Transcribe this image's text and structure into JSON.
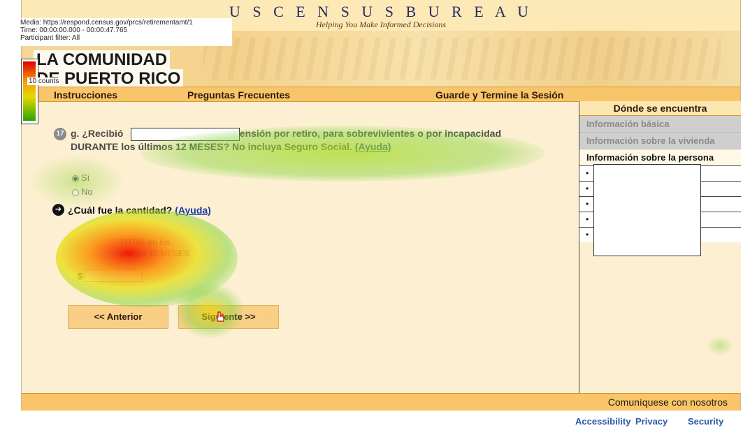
{
  "overlay": {
    "media": "Media: https://respond.census.gov/prcs/retirementamt/1",
    "time": "Time: 00:00:00.000 - 00:00:47.765",
    "participant_filter": "Participant filter: All",
    "legend_label": "10 counts"
  },
  "header": {
    "brand": "U S C E N S U S B U R E A U",
    "tagline": "Helping You Make Informed Decisions",
    "banner_line1": "LA COMUNIDAD",
    "banner_line2": "DE PUERTO RICO"
  },
  "nav": {
    "instrucciones": "Instrucciones",
    "preguntas": "Preguntas Frecuentes",
    "guarde": "Guarde y Termine la Sesión"
  },
  "question": {
    "number": "17",
    "text_start": "g. ¿Recibió",
    "text_rest": "pensión por retiro, para sobrevivientes o por incapacidad DURANTE los últimos 12 MESES? No incluya Seguro Social.",
    "help": "(Ayuda)",
    "option_yes": "Sí",
    "option_no": "No",
    "option_yes_selected": true
  },
  "followup": {
    "label": "¿Cuál fue la cantidad?",
    "help": "(Ayuda)",
    "period_line1": "TOTAL en los",
    "period_line2": "últimos 12 MESES",
    "dollar_sign": "$",
    "amount_value": ""
  },
  "buttons": {
    "previous": "<<  Anterior",
    "next": "Siguiente  >>"
  },
  "sidebar": {
    "title": "Dónde se encuentra",
    "items": [
      {
        "label": "Información básica",
        "state": "done"
      },
      {
        "label": "Información sobre la vivienda",
        "state": "done"
      },
      {
        "label": "Información sobre la persona",
        "state": "current"
      }
    ],
    "bullet": "•"
  },
  "footer": {
    "contact": "Comuníquese con nosotros",
    "accessibility": "Accessibility",
    "privacy": "Privacy",
    "security": "Security"
  },
  "colors": {
    "nav_bar": "#f9c56a",
    "page_bg": "#fdf0d2",
    "link": "#2a5aa8"
  }
}
